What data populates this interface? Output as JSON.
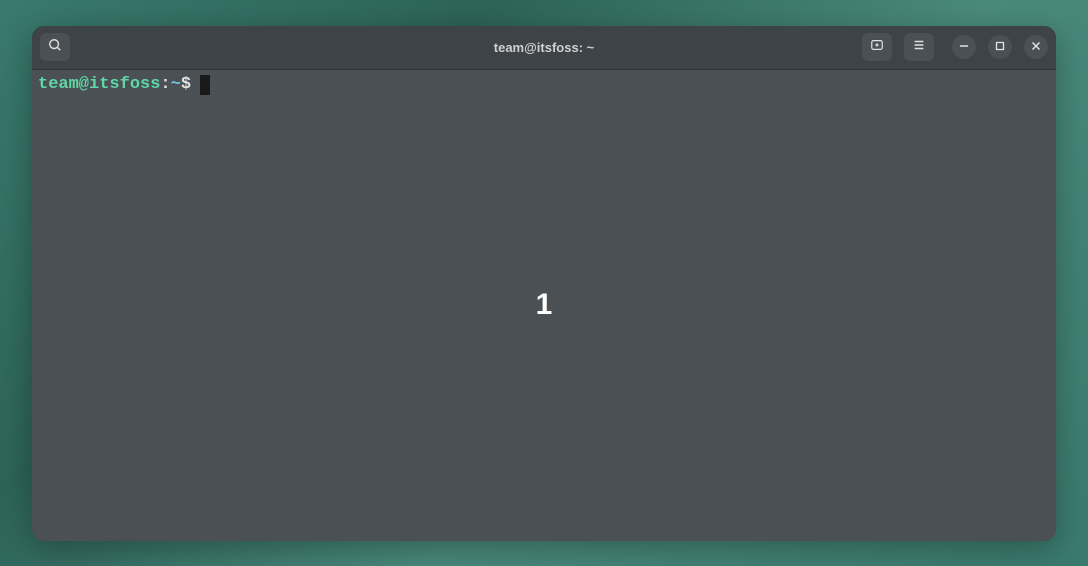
{
  "window": {
    "title": "team@itsfoss: ~"
  },
  "terminal": {
    "prompt": {
      "user_host": "team@itsfoss",
      "separator": ":",
      "path": "~",
      "symbol": "$"
    },
    "command": ""
  },
  "overlay": {
    "text": "1"
  },
  "icons": {
    "search": "search-icon",
    "new_tab": "new-tab-icon",
    "menu": "hamburger-menu-icon",
    "minimize": "minimize-icon",
    "maximize": "maximize-icon",
    "close": "close-icon"
  }
}
